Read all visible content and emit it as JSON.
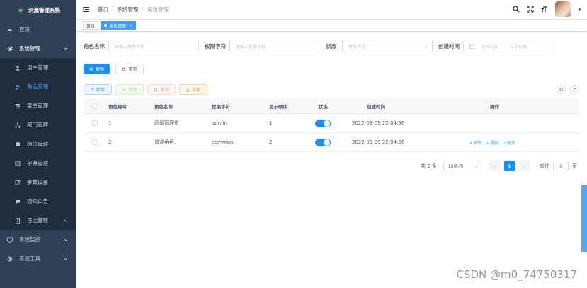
{
  "brand": {
    "title": "洞源管理系统"
  },
  "sidebar": {
    "items": [
      {
        "label": "首页",
        "icon": "dashboard-icon"
      },
      {
        "label": "系统管理",
        "icon": "gear-icon"
      }
    ],
    "sub_items": [
      {
        "label": "用户管理",
        "icon": "user-icon"
      },
      {
        "label": "角色管理",
        "icon": "peoples-icon"
      },
      {
        "label": "菜单管理",
        "icon": "tree-table-icon"
      },
      {
        "label": "部门管理",
        "icon": "tree-icon"
      },
      {
        "label": "岗位管理",
        "icon": "post-icon"
      },
      {
        "label": "字典管理",
        "icon": "dict-icon"
      },
      {
        "label": "参数设置",
        "icon": "edit-icon"
      },
      {
        "label": "通知公告",
        "icon": "message-icon"
      },
      {
        "label": "日志管理",
        "icon": "log-icon"
      }
    ],
    "bottom_items": [
      {
        "label": "系统监控",
        "icon": "monitor-icon"
      },
      {
        "label": "系统工具",
        "icon": "tool-icon"
      }
    ],
    "active_color": "#409eff"
  },
  "breadcrumb": {
    "items": [
      "首页",
      "系统管理",
      "角色管理"
    ]
  },
  "tags": {
    "home": "首页",
    "active": "角色管理"
  },
  "search": {
    "role_name_label": "角色名称",
    "role_name_placeholder": "请输入角色名称",
    "role_key_label": "权限字符",
    "role_key_placeholder": "请输入权限字符",
    "status_label": "状态",
    "status_placeholder": "角色状态",
    "date_label": "创建时间",
    "date_start": "开始日期",
    "date_sep": "-",
    "date_end": "结束日期",
    "search_btn": "搜索",
    "reset_btn": "重置"
  },
  "toolbar": {
    "add": "新增",
    "edit": "修改",
    "delete": "删除",
    "export": "导出"
  },
  "table": {
    "columns": [
      "角色编号",
      "角色名称",
      "权限字符",
      "显示顺序",
      "状态",
      "创建时间",
      "操作"
    ],
    "rows": [
      {
        "id": "1",
        "name": "超级管理员",
        "key": "admin",
        "sort": "1",
        "status_on": true,
        "created": "2022-03-09 22:04:56",
        "ops": []
      },
      {
        "id": "2",
        "name": "普通角色",
        "key": "common",
        "sort": "2",
        "status_on": true,
        "created": "2022-03-09 22:04:56",
        "ops": [
          "修改",
          "删除",
          "更多"
        ]
      }
    ]
  },
  "pagination": {
    "total": "共 2 条",
    "page_size": "10条/页",
    "current": "1",
    "goto_label": "前往",
    "goto_value": "1",
    "page_suffix": "页"
  },
  "watermark": "CSDN @m0_74750317",
  "colors": {
    "sidebar_bg": "#304156",
    "primary": "#1890ff"
  }
}
